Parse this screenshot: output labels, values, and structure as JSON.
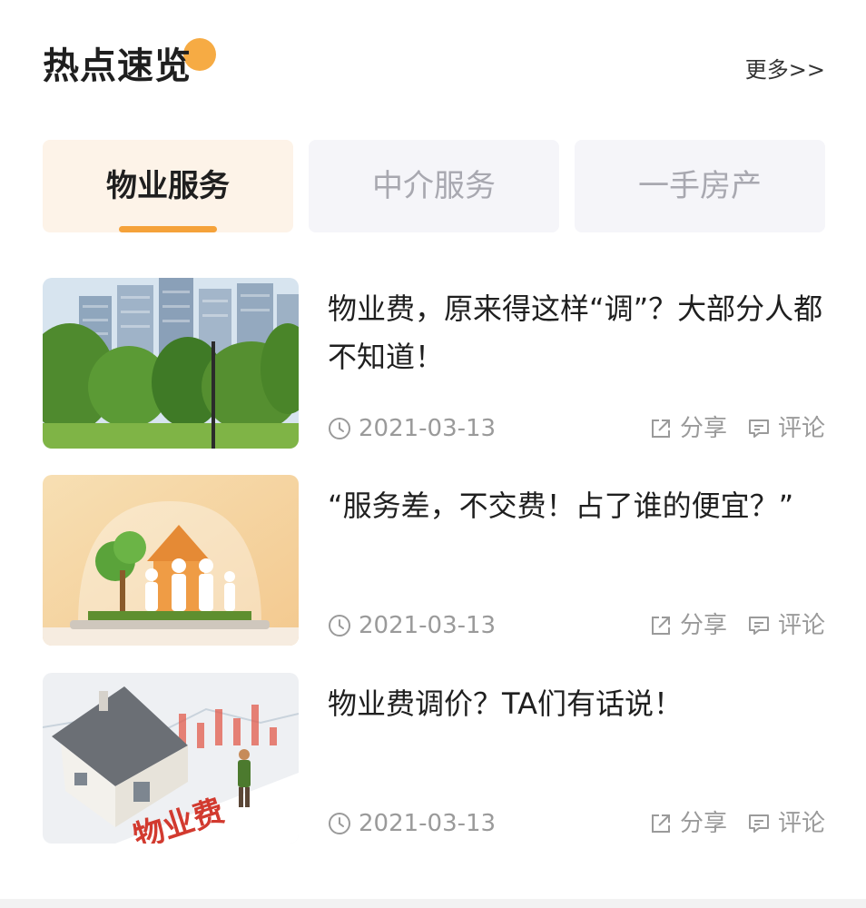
{
  "header": {
    "title": "热点速览",
    "more": "更多>>"
  },
  "tabs": [
    {
      "label": "物业服务",
      "active": true
    },
    {
      "label": "中介服务",
      "active": false
    },
    {
      "label": "一手房产",
      "active": false
    }
  ],
  "articles": [
    {
      "title": "物业费，原来得这样“调”？大部分人都不知道！",
      "date": "2021-03-13",
      "share": "分享",
      "comment": "评论",
      "thumb": "apartment-buildings-image"
    },
    {
      "title": "“服务差，不交费！占了谁的便宜？”",
      "date": "2021-03-13",
      "share": "分享",
      "comment": "评论",
      "thumb": "family-house-dome-image"
    },
    {
      "title": "物业费调价？TA们有话说！",
      "date": "2021-03-13",
      "share": "分享",
      "comment": "评论",
      "thumb": "house-model-property-fee-image"
    }
  ],
  "colors": {
    "accent": "#f5a23a",
    "active_tab_bg": "#fdf3e8",
    "inactive_tab_bg": "#f5f5f9"
  },
  "image_text": {
    "thumb3_caption": "物业费"
  }
}
